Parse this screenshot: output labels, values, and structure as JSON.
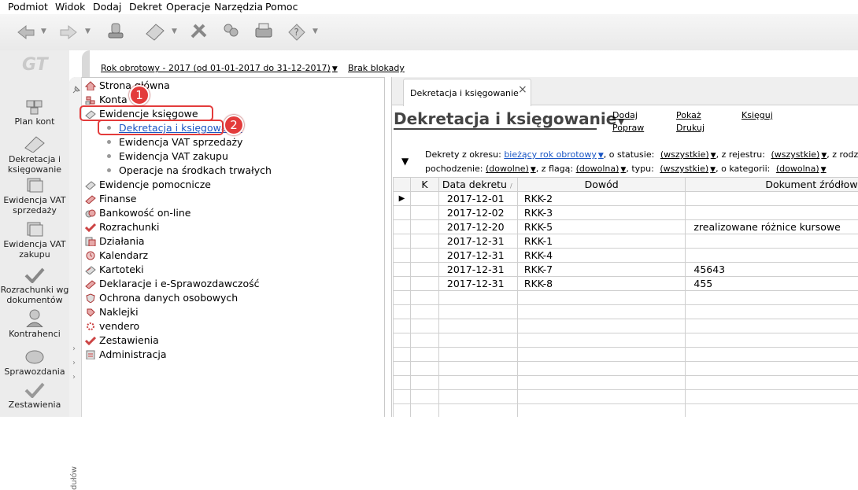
{
  "menu": [
    "Podmiot",
    "Widok",
    "Dodaj",
    "Dekret",
    "Operacje",
    "Narzędzia",
    "Pomoc"
  ],
  "header": {
    "year_selector": "Rok obrotowy - 2017  (od 01-01-2017 do 31-12-2017)",
    "lock_status": "Brak blokady"
  },
  "sidebar": {
    "items": [
      {
        "label_line1": "Plan kont",
        "label_line2": "",
        "icon": "chart-of-accounts-icon"
      },
      {
        "label_line1": "Dekretacja i",
        "label_line2": "księgowanie",
        "icon": "posting-icon"
      },
      {
        "label_line1": "Ewidencja VAT",
        "label_line2": "sprzedaży",
        "icon": "vat-sales-icon"
      },
      {
        "label_line1": "Ewidencja VAT",
        "label_line2": "zakupu",
        "icon": "vat-purchase-icon"
      },
      {
        "label_line1": "Rozrachunki wg",
        "label_line2": "dokumentów",
        "icon": "settlements-icon"
      },
      {
        "label_line1": "Kontrahenci",
        "label_line2": "",
        "icon": "contractors-icon"
      },
      {
        "label_line1": "Sprawozdania",
        "label_line2": "",
        "icon": "reports-icon"
      },
      {
        "label_line1": "Zestawienia",
        "label_line2": "",
        "icon": "summaries-icon"
      }
    ],
    "vertical_label": "dułów"
  },
  "tree": {
    "items": [
      {
        "label": "Strona główna",
        "level": 0
      },
      {
        "label": "Konta",
        "level": 0
      },
      {
        "label": "Ewidencje księgowe",
        "level": 0
      },
      {
        "label": "Dekretacja i księgowanie",
        "level": 1
      },
      {
        "label": "Ewidencja VAT sprzedaży",
        "level": 1
      },
      {
        "label": "Ewidencja VAT zakupu",
        "level": 1
      },
      {
        "label": "Operacje na środkach trwałych",
        "level": 1
      },
      {
        "label": "Ewidencje pomocnicze",
        "level": 0
      },
      {
        "label": "Finanse",
        "level": 0
      },
      {
        "label": "Bankowość on-line",
        "level": 0
      },
      {
        "label": "Rozrachunki",
        "level": 0
      },
      {
        "label": "Działania",
        "level": 0
      },
      {
        "label": "Kalendarz",
        "level": 0
      },
      {
        "label": "Kartoteki",
        "level": 0
      },
      {
        "label": "Deklaracje i e-Sprawozdawczość",
        "level": 0
      },
      {
        "label": "Ochrona danych osobowych",
        "level": 0
      },
      {
        "label": "Naklejki",
        "level": 0
      },
      {
        "label": "vendero",
        "level": 0
      },
      {
        "label": "Zestawienia",
        "level": 0
      },
      {
        "label": "Administracja",
        "level": 0
      }
    ]
  },
  "callouts": [
    "1",
    "2"
  ],
  "tab": {
    "label": "Dekretacja i księgowanie",
    "close": "×"
  },
  "main": {
    "title": "Dekretacja i księgowanie",
    "actions": {
      "dodaj": "Dodaj",
      "popraw": "Popraw",
      "pokaz": "Pokaż",
      "drukuj": "Drukuj",
      "ksieguj": "Księguj"
    },
    "filters": {
      "okres_label": "Dekrety z okresu:",
      "okres_value": "bieżący rok obrotowy",
      "status_label": ", o statusie:",
      "status_value": "(wszystkie)",
      "rejestr_label": ", z rejestru:",
      "rejestr_value": "(wszystkie)",
      "rodzaj_label": ", z rodzajem",
      "pochodzenie_label": "pochodzenie:",
      "pochodzenie_value": "(dowolne)",
      "flaga_label": ", z flagą:",
      "flaga_value": "(dowolna)",
      "typ_label": ", typu:",
      "typ_value": "(wszystkie)",
      "kategoria_label": ", o kategorii:",
      "kategoria_value": "(dowolna)"
    }
  },
  "table": {
    "columns": [
      "K",
      "Data dekretu",
      "Dowód",
      "Dokument źródłowy"
    ],
    "rows": [
      {
        "k": "",
        "date": "2017-12-01",
        "dowod": "RKK-2",
        "doc": ""
      },
      {
        "k": "",
        "date": "2017-12-02",
        "dowod": "RKK-3",
        "doc": ""
      },
      {
        "k": "",
        "date": "2017-12-20",
        "dowod": "RKK-5",
        "doc": "zrealizowane różnice kursowe"
      },
      {
        "k": "",
        "date": "2017-12-31",
        "dowod": "RKK-1",
        "doc": ""
      },
      {
        "k": "",
        "date": "2017-12-31",
        "dowod": "RKK-4",
        "doc": ""
      },
      {
        "k": "",
        "date": "2017-12-31",
        "dowod": "RKK-7",
        "doc": "45643"
      },
      {
        "k": "",
        "date": "2017-12-31",
        "dowod": "RKK-8",
        "doc": "455"
      }
    ],
    "empty_rows": 9
  }
}
